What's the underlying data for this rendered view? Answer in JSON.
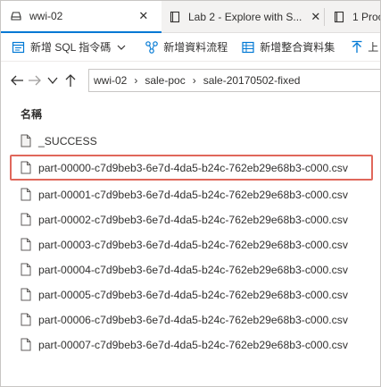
{
  "tabs": [
    {
      "label": "wwi-02",
      "icon": "storage-icon",
      "active": true
    },
    {
      "label": "Lab 2 - Explore with S...",
      "icon": "notebook-icon",
      "active": false
    },
    {
      "label": "1 Proc",
      "icon": "notebook-icon",
      "active": false
    }
  ],
  "toolbar": {
    "new_sql_script": "新增 SQL 指令碼",
    "new_data_flow": "新增資料流程",
    "new_integration_dataset": "新增整合資料集",
    "upload": "上"
  },
  "breadcrumb": [
    "wwi-02",
    "sale-poc",
    "sale-20170502-fixed"
  ],
  "list": {
    "column_name": "名稱",
    "files": [
      {
        "name": "_SUCCESS",
        "selected": false
      },
      {
        "name": "part-00000-c7d9beb3-6e7d-4da5-b24c-762eb29e68b3-c000.csv",
        "selected": true
      },
      {
        "name": "part-00001-c7d9beb3-6e7d-4da5-b24c-762eb29e68b3-c000.csv",
        "selected": false
      },
      {
        "name": "part-00002-c7d9beb3-6e7d-4da5-b24c-762eb29e68b3-c000.csv",
        "selected": false
      },
      {
        "name": "part-00003-c7d9beb3-6e7d-4da5-b24c-762eb29e68b3-c000.csv",
        "selected": false
      },
      {
        "name": "part-00004-c7d9beb3-6e7d-4da5-b24c-762eb29e68b3-c000.csv",
        "selected": false
      },
      {
        "name": "part-00005-c7d9beb3-6e7d-4da5-b24c-762eb29e68b3-c000.csv",
        "selected": false
      },
      {
        "name": "part-00006-c7d9beb3-6e7d-4da5-b24c-762eb29e68b3-c000.csv",
        "selected": false
      },
      {
        "name": "part-00007-c7d9beb3-6e7d-4da5-b24c-762eb29e68b3-c000.csv",
        "selected": false
      }
    ]
  },
  "colors": {
    "accent": "#0078d4",
    "highlight_border": "#e0675b",
    "icon_blue": "#0078d4"
  }
}
